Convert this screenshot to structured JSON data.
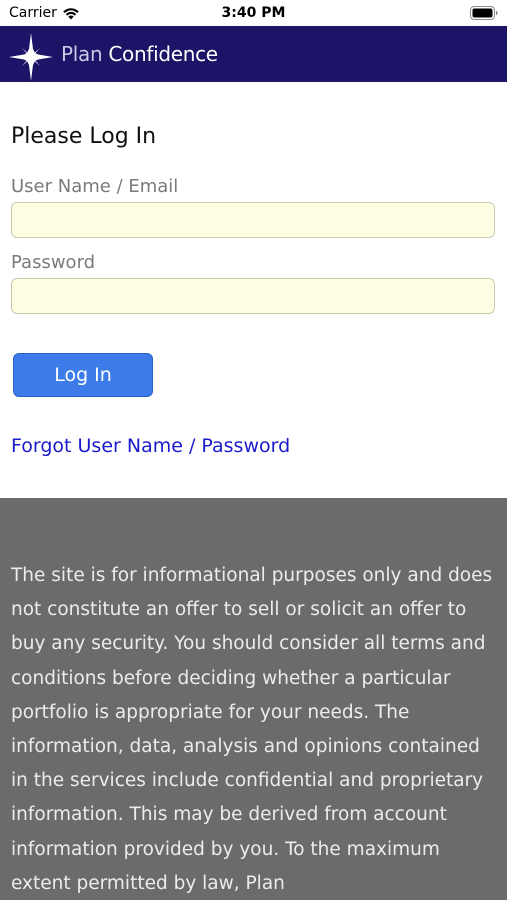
{
  "status_bar": {
    "carrier": "Carrier",
    "time": "3:40 PM"
  },
  "header": {
    "brand_word1": "Plan",
    "brand_word2": "Confidence",
    "colors": {
      "background": "#1c1466",
      "star": "#ffffff"
    }
  },
  "login": {
    "title": "Please Log In",
    "username_label": "User Name / Email",
    "username_value": "",
    "password_label": "Password",
    "password_value": "",
    "login_button": "Log In",
    "forgot_link": "Forgot User Name / Password",
    "colors": {
      "field_bg": "#fefee3",
      "button_bg": "#3d7ce8",
      "link": "#1a1acc"
    }
  },
  "disclaimer": {
    "text": "The site is for informational purposes only and does not constitute an offer to sell or solicit an offer to buy any security. You should consider all terms and conditions before deciding whether a particular portfolio is appropriate for your needs. The information, data, analysis and opinions contained in the services include confidential and proprietary information. This may be derived from account information provided by you. To the maximum extent permitted by law, Plan",
    "colors": {
      "background": "#6b6b6b",
      "text": "#ececec"
    }
  },
  "icons": [
    "wifi-icon",
    "battery-icon",
    "north-star-logo-icon"
  ]
}
